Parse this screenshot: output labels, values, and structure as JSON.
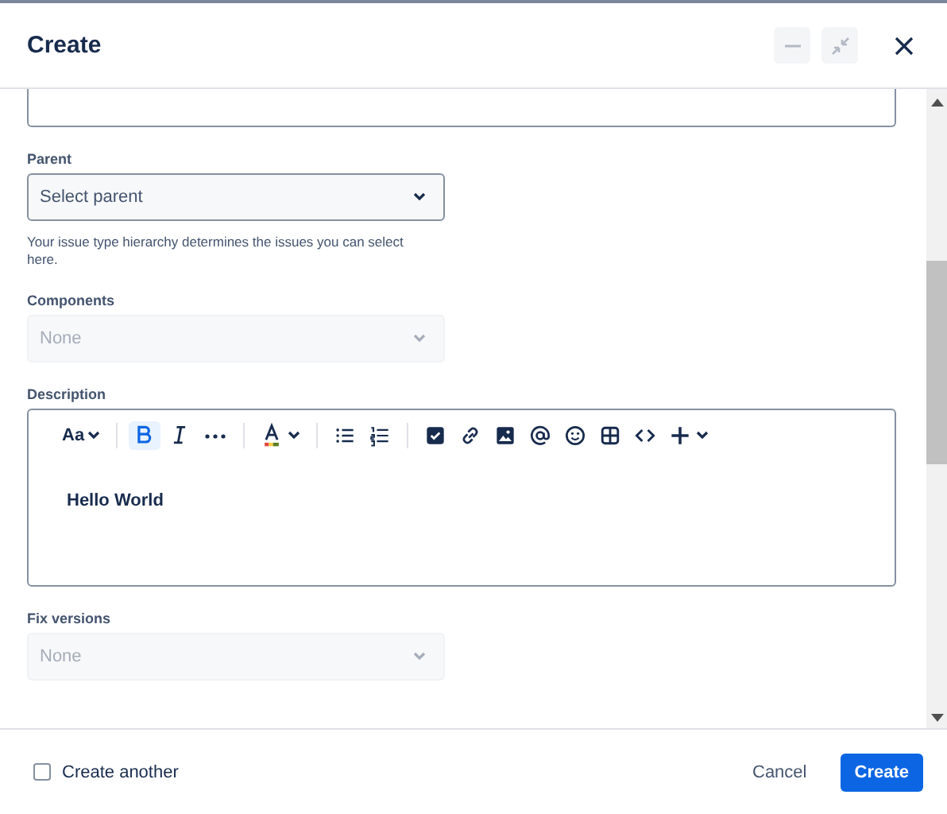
{
  "window": {
    "title": "Create"
  },
  "header_buttons": [
    {
      "kind": "minimize",
      "disabled": true
    },
    {
      "kind": "collapse",
      "disabled": true
    },
    {
      "kind": "close",
      "disabled": false
    }
  ],
  "fields": [
    {
      "kind": "input"
    },
    {
      "kind": "select",
      "label": "Parent",
      "placeholder": "Select parent",
      "disabled": false,
      "help": "Your issue type hierarchy determines the issues you can select here."
    },
    {
      "kind": "select",
      "label": "Components",
      "placeholder": "None",
      "disabled": true
    },
    {
      "kind": "editor",
      "label": "Description",
      "toolbar": [
        {
          "kind": "text-style",
          "label": "Aa"
        },
        {
          "kind": "sep"
        },
        {
          "kind": "bold",
          "selected": true
        },
        {
          "kind": "italic",
          "selected": false
        },
        {
          "kind": "more"
        },
        {
          "kind": "sep"
        },
        {
          "kind": "text-color"
        },
        {
          "kind": "sep"
        },
        {
          "kind": "bullet-list"
        },
        {
          "kind": "number-list"
        },
        {
          "kind": "sep"
        },
        {
          "kind": "task"
        },
        {
          "kind": "link"
        },
        {
          "kind": "image"
        },
        {
          "kind": "mention"
        },
        {
          "kind": "emoji"
        },
        {
          "kind": "table"
        },
        {
          "kind": "code"
        },
        {
          "kind": "insert"
        }
      ],
      "value": "Hello World"
    },
    {
      "kind": "select",
      "label": "Fix versions",
      "placeholder": "None",
      "disabled": true
    }
  ],
  "footer": {
    "create_another": {
      "label": "Create another",
      "checked": false
    },
    "buttons": [
      {
        "label": "Cancel",
        "kind": "subtle"
      },
      {
        "label": "Create",
        "kind": "primary"
      }
    ]
  }
}
